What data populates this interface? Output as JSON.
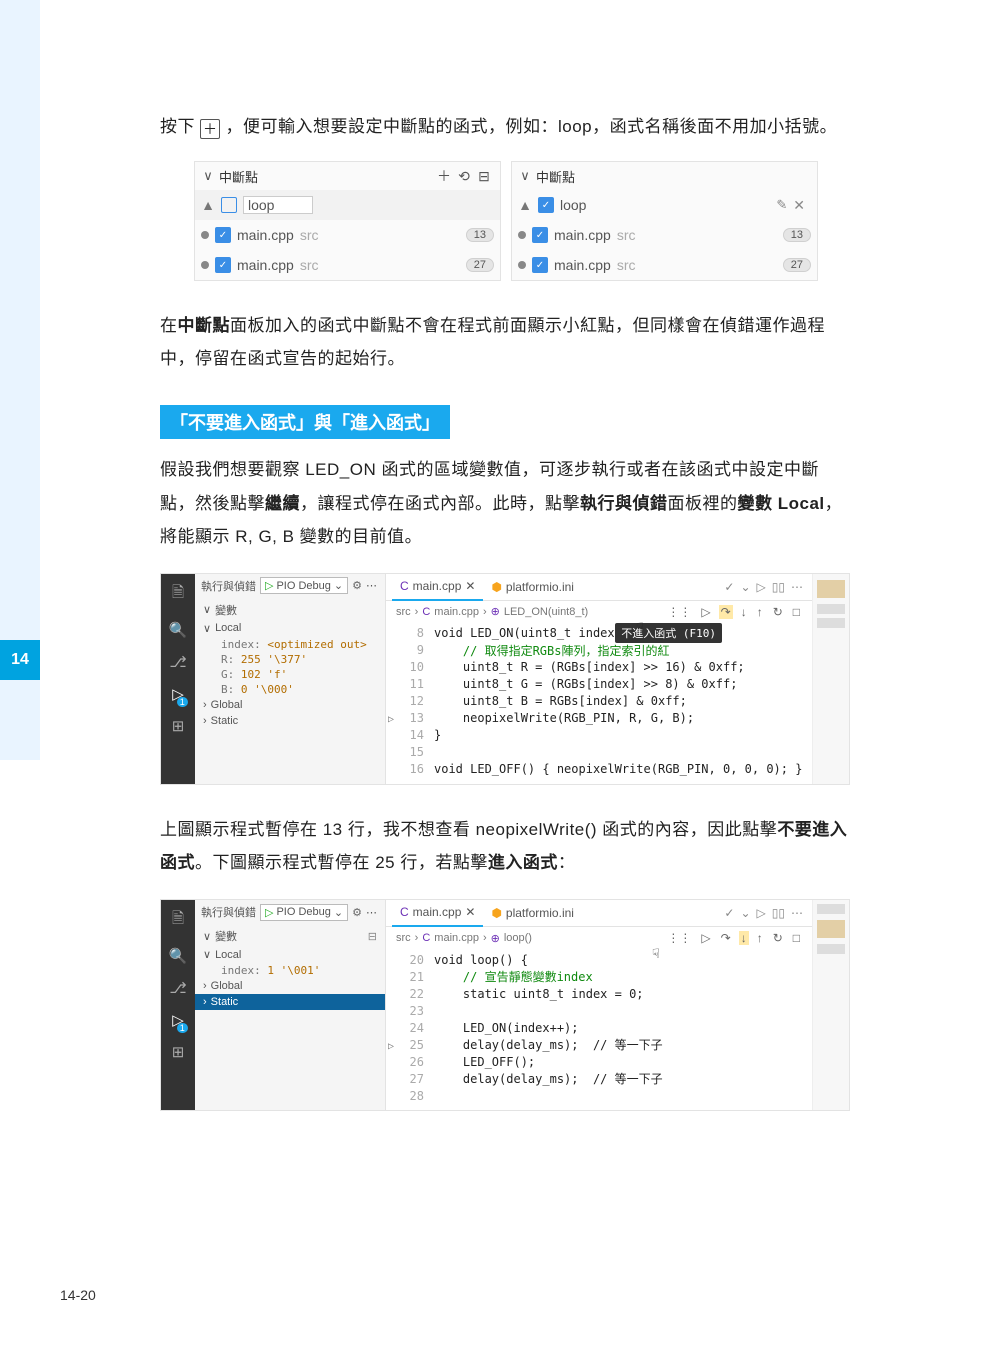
{
  "chapter_tab": "14",
  "page_number": "14-20",
  "intro_pre": "按下 ",
  "intro_post": "，便可輸入想要設定中斷點的函式，例如：loop，函式名稱後面不用加小括號。",
  "plus_glyph": "＋",
  "bp_panels": {
    "title": "中斷點",
    "toggle": "∨",
    "left": {
      "func": "loop",
      "rows": [
        {
          "file": "main.cpp",
          "loc": "src",
          "line": "13"
        },
        {
          "file": "main.cpp",
          "loc": "src",
          "line": "27"
        }
      ]
    },
    "right": {
      "func": "loop",
      "rows": [
        {
          "file": "main.cpp",
          "loc": "src",
          "line": "13"
        },
        {
          "file": "main.cpp",
          "loc": "src",
          "line": "27"
        }
      ]
    }
  },
  "para2_a": "在",
  "para2_b": "中斷點",
  "para2_c": "面板加入的函式中斷點不會在程式前面顯示小紅點，但同樣會在偵錯運作過程中，停留在函式宣告的起始行。",
  "heading1": "「不要進入函式」與「進入函式」",
  "para3_a": "假設我們想要觀察 LED_ON 函式的區域變數值，可逐步執行或者在該函式中設定中斷點，然後點擊",
  "para3_b": "繼續",
  "para3_c": "，讓程式停在函式內部。此時，點擊",
  "para3_d": "執行與偵錯",
  "para3_e": "面板裡的",
  "para3_f": "變數 Local",
  "para3_g": "，將能顯示 R, G, B 變數的目前值。",
  "ide1": {
    "topbar": {
      "label": "執行與偵錯",
      "config": "PIO Debug"
    },
    "vars_title": "變數",
    "local": "Local",
    "global": "Global",
    "static": "Static",
    "locals": [
      {
        "k": "index:",
        "v": "<optimized out>"
      },
      {
        "k": "R:",
        "v": "255 '\\377'"
      },
      {
        "k": "G:",
        "v": "102 'f'"
      },
      {
        "k": "B:",
        "v": "0 '\\000'"
      }
    ],
    "tab1": "main.cpp",
    "tab2": "platformio.ini",
    "crumb_src": "src",
    "crumb_file": "main.cpp",
    "crumb_fn": "LED_ON(uint8_t)",
    "tooltip": "不進入函式 (F10)",
    "lines": [
      {
        "n": "8",
        "t": "void LED_ON(uint8_t index) {",
        "cls": ""
      },
      {
        "n": "9",
        "t": "    // 取得指定RGBs陣列，指定索引的紅",
        "cls": "cm"
      },
      {
        "n": "10",
        "t": "    uint8_t R = (RGBs[index] >> 16) & 0xff;",
        "cls": ""
      },
      {
        "n": "11",
        "t": "    uint8_t G = (RGBs[index] >> 8) & 0xff;",
        "cls": ""
      },
      {
        "n": "12",
        "t": "    uint8_t B = RGBs[index] & 0xff;",
        "cls": ""
      },
      {
        "n": "13",
        "t": "    neopixelWrite(RGB_PIN, R, G, B);",
        "cls": "",
        "cur": true
      },
      {
        "n": "14",
        "t": "}",
        "cls": ""
      },
      {
        "n": "15",
        "t": "",
        "cls": ""
      },
      {
        "n": "16",
        "t": "void LED_OFF() { neopixelWrite(RGB_PIN, 0, 0, 0); }",
        "cls": ""
      }
    ]
  },
  "para4_a": "上圖顯示程式暫停在 13 行，我不想查看 neopixelWrite() 函式的內容，因此點擊",
  "para4_b": "不要進入函式",
  "para4_c": "。下圖顯示程式暫停在 25 行，若點擊",
  "para4_d": "進入函式",
  "para4_e": "：",
  "ide2": {
    "topbar": {
      "label": "執行與偵錯",
      "config": "PIO Debug"
    },
    "vars_title": "變數",
    "local": "Local",
    "global": "Global",
    "static": "Static",
    "locals": [
      {
        "k": "index:",
        "v": "1 '\\001'"
      }
    ],
    "tab1": "main.cpp",
    "tab2": "platformio.ini",
    "crumb_src": "src",
    "crumb_file": "main.cpp",
    "crumb_fn": "loop()",
    "lines": [
      {
        "n": "20",
        "t": "void loop() {",
        "cls": ""
      },
      {
        "n": "21",
        "t": "    // 宣告靜態變數index",
        "cls": "cm"
      },
      {
        "n": "22",
        "t": "    static uint8_t index = 0;",
        "cls": ""
      },
      {
        "n": "23",
        "t": "",
        "cls": ""
      },
      {
        "n": "24",
        "t": "    LED_ON(index++);",
        "cls": ""
      },
      {
        "n": "25",
        "t": "    delay(delay_ms);  // 等一下子",
        "cls": "",
        "cur": true
      },
      {
        "n": "26",
        "t": "    LED_OFF();",
        "cls": ""
      },
      {
        "n": "27",
        "t": "    delay(delay_ms);  // 等一下子",
        "cls": ""
      },
      {
        "n": "28",
        "t": "",
        "cls": ""
      }
    ]
  }
}
